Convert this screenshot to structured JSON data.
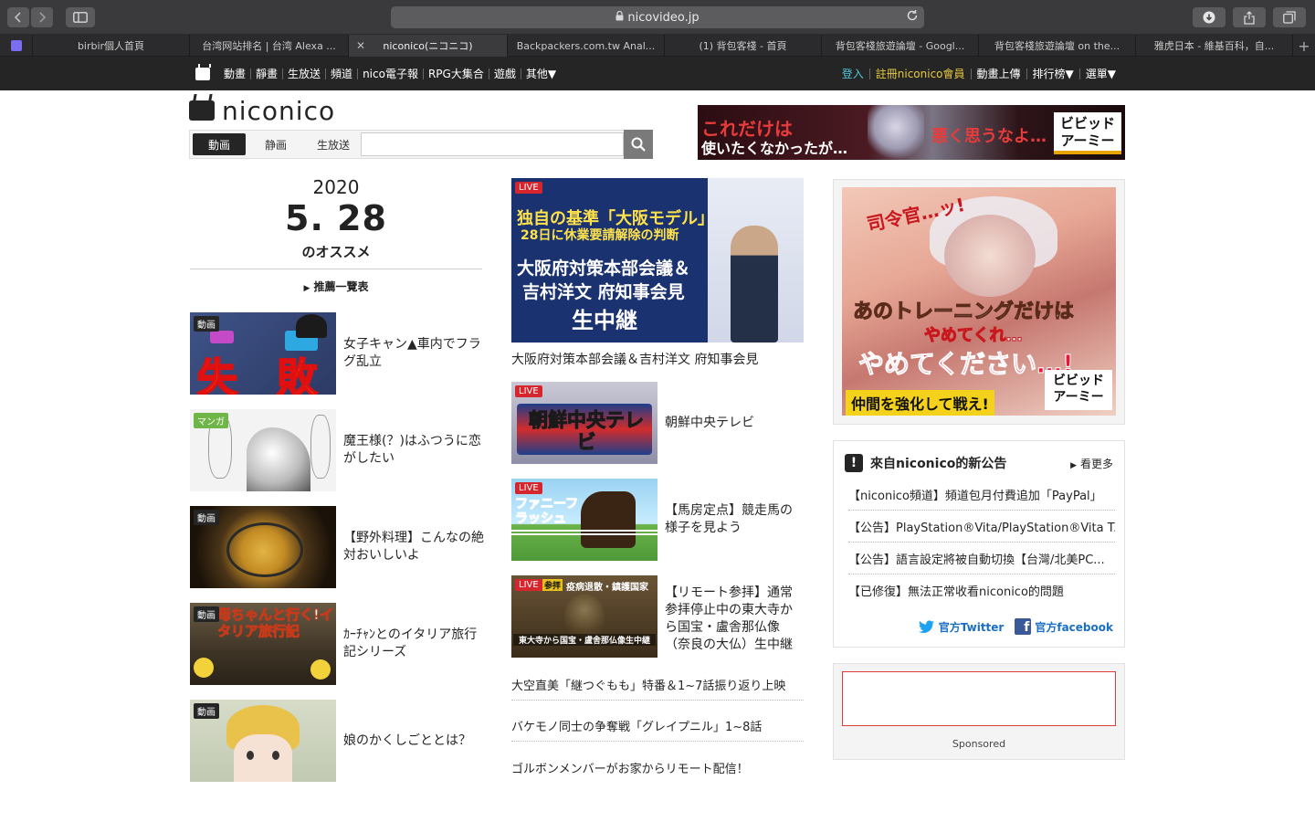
{
  "browser": {
    "address": "nicovideo.jp",
    "tabs": [
      {
        "label": "birbir個人首頁",
        "active": false
      },
      {
        "label": "台湾网站排名 | 台湾 Alexa ...",
        "active": false
      },
      {
        "label": "niconico(ニコニコ)",
        "active": true
      },
      {
        "label": "Backpackers.com.tw Anal...",
        "active": false
      },
      {
        "label": "(1) 背包客棧 - 首頁",
        "active": false
      },
      {
        "label": "背包客棧旅遊論壇 - Googl...",
        "active": false
      },
      {
        "label": "背包客棧旅遊論壇 on the...",
        "active": false
      },
      {
        "label": "雅虎日本 - 維基百科，自...",
        "active": false
      }
    ]
  },
  "nav": {
    "left": [
      "動畫",
      "靜畫",
      "生放送",
      "頻道",
      "nico電子報",
      "RPG大集合",
      "遊戲",
      "其他▼"
    ],
    "login": "登入",
    "register": "註冊niconico會員",
    "upload": "動畫上傳",
    "ranking": "排行榜▼",
    "menu": "選單▼"
  },
  "header": {
    "logo_text": "niconico",
    "search_tabs": [
      "動画",
      "静画",
      "生放送"
    ],
    "search_placeholder": ""
  },
  "banner_top": {
    "line1": "これだけは",
    "line2": "使いたくなかったが…",
    "line3": "悪く思うなよ…",
    "logo": "ビビッド\nアーミー"
  },
  "recommend": {
    "year": "2020",
    "month_day": "5. 28",
    "subtitle": "のオススメ",
    "all_link": "推薦一覽表",
    "items": [
      {
        "badge": "動画",
        "title": "女子キャン▲車内でフラグ乱立",
        "thumb_text": "失 敗",
        "color": "#4a5f92"
      },
      {
        "badge": "マンガ",
        "title": "魔王様(？)はふつうに恋がしたい",
        "thumb_text": "",
        "color": "#e6e6e6"
      },
      {
        "badge": "動画",
        "title": "【野外料理】こんなの絶対おいしいよ",
        "thumb_text": "",
        "color": "#5a4a2a"
      },
      {
        "badge": "動画",
        "title": "ｶｰﾁｬﾝとのイタリア旅行記シリーズ",
        "thumb_text": "母ちゃんと行く!イタリア旅行記",
        "color": "#5a4e3a"
      },
      {
        "badge": "動画",
        "title": "娘のかくしごととは？",
        "thumb_text": "",
        "color": "#cfd8c4"
      }
    ]
  },
  "live_main": {
    "tag": "LIVE",
    "line1": "独自の基準「大阪モデル」",
    "line2": "28日に休業要請解除の判断",
    "line3": "大阪府対策本部会議＆",
    "line4": "吉村洋文 府知事会見",
    "line5": "生中継",
    "caption": "大阪府対策本部会議＆吉村洋文 府知事会見"
  },
  "live_items": [
    {
      "tag": "LIVE",
      "title": "朝鮮中央テレビ",
      "thumb_text": "朝鮮中央テレビ"
    },
    {
      "tag": "LIVE",
      "title": "【馬房定点】競走馬の様子を見よう",
      "thumb_text": "ファニーフラッシュ"
    },
    {
      "tag": "LIVE",
      "title": "【リモート参拝】通常参拝停止中の東大寺から国宝・盧舎那仏像（奈良の大仏）生中継",
      "thumb_text": "東大寺から国宝・盧舎那仏像生中継",
      "thumb_head": "疫病退散・鎮護国家",
      "thumb_badge": "参拝"
    }
  ],
  "news": [
    "大空直美「継つぐもも」特番＆1~7話振り返り上映",
    "バケモノ同士の争奪戦「グレイプニル」1~8話",
    "ゴルボンメンバーがお家からリモート配信！"
  ],
  "side_ad": {
    "line1": "司令官…ッ!",
    "line2": "あのトレーニングだけは",
    "line3": "やめてくれ…",
    "line4": "やめてください…!",
    "line5": "仲間を強化して戦え!",
    "logo": "ビビッド\nアーミー"
  },
  "notice": {
    "title": "來自niconico的新公告",
    "more": "看更多",
    "items": [
      "【niconico頻道】頻道包月付費追加「PayPal」",
      "【公告】PlayStation®Vita/PlayStation®Vita T...",
      "【公告】語言設定將被自動切換【台灣/北美PC...",
      "【已修復】無法正常收看niconico的問題"
    ],
    "twitter": "官方Twitter",
    "facebook": "官方facebook"
  },
  "sponsored": {
    "label": "Sponsored"
  }
}
